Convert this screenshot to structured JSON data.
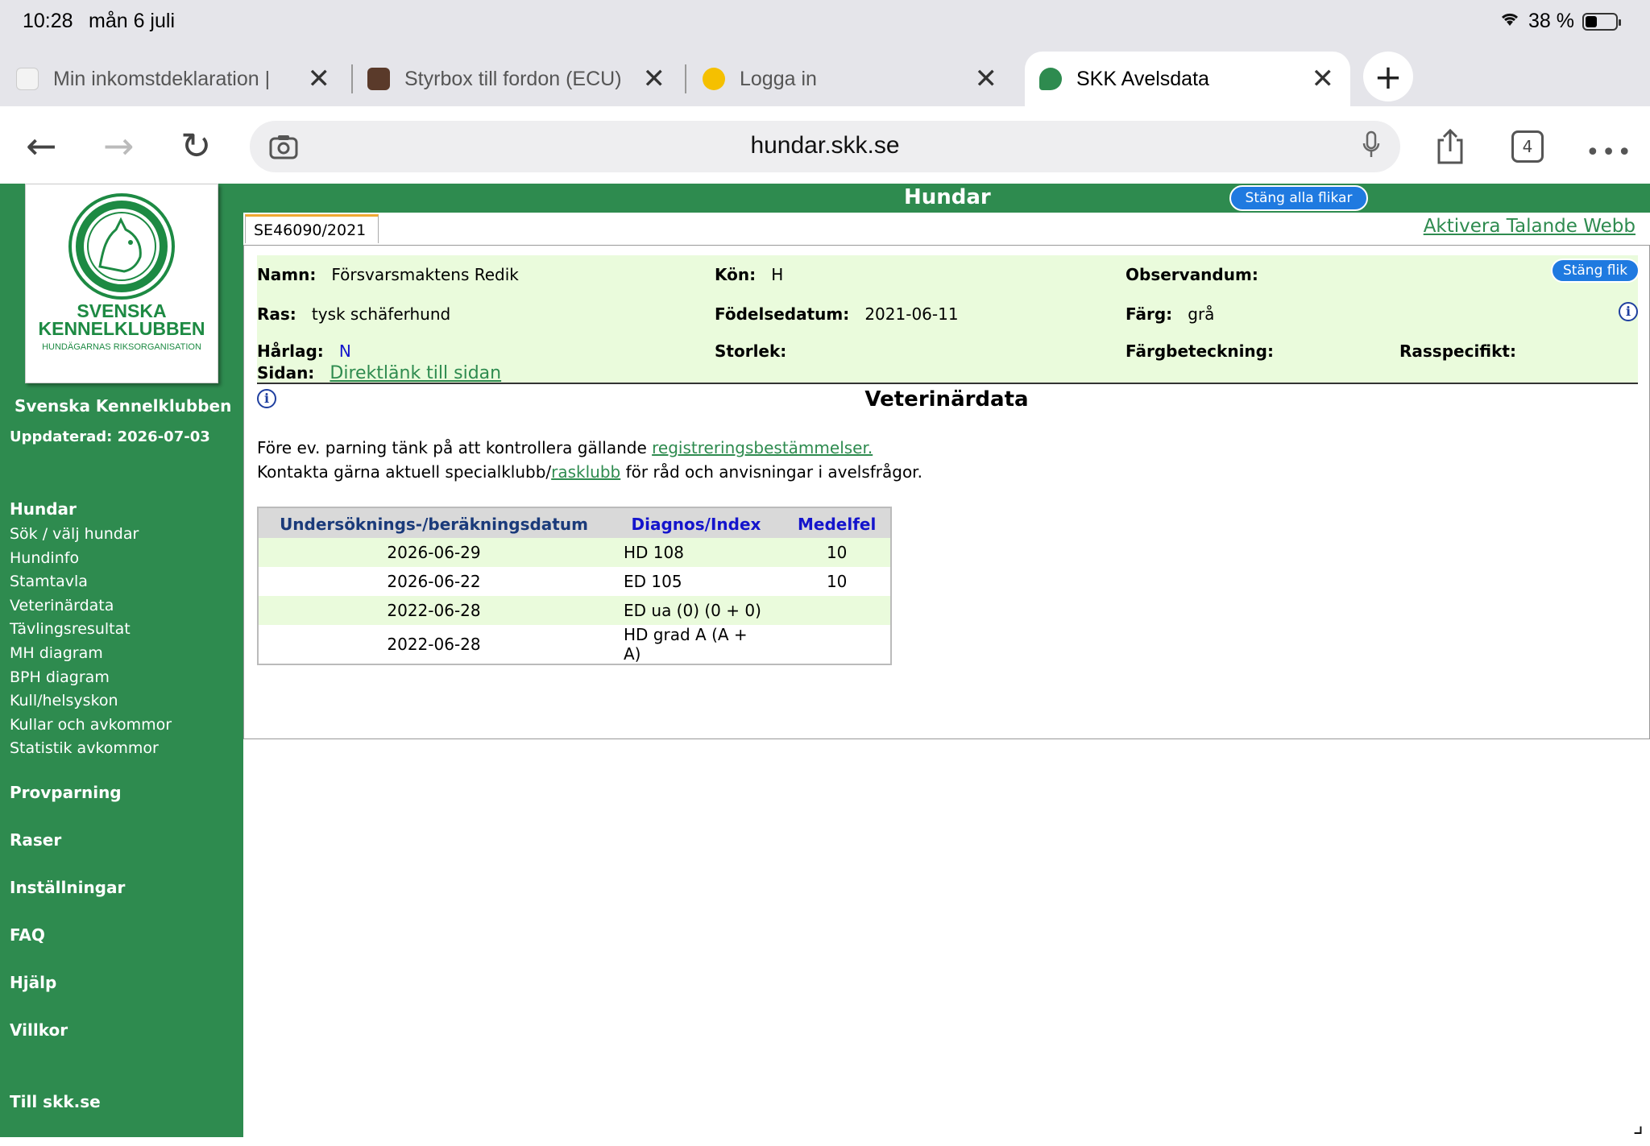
{
  "status_bar": {
    "time": "10:28",
    "date": "mån 6 juli",
    "battery": "38 %"
  },
  "browser": {
    "tabs": [
      {
        "title": "Min inkomstdeklaration |",
        "active": false
      },
      {
        "title": "Styrbox till fordon (ECU)",
        "active": false
      },
      {
        "title": "Logga in",
        "active": false
      },
      {
        "title": "SKK Avelsdata",
        "active": true
      }
    ],
    "url": "hundar.skk.se",
    "tab_count": "4"
  },
  "sidebar": {
    "logo_line1": "SVENSKA",
    "logo_line2": "KENNELKLUBBEN",
    "logo_line3": "HUNDÄGARNAS RIKSORGANISATION",
    "club_name": "Svenska Kennelklubben",
    "updated": "Uppdaterad: 2026-07-03",
    "nav_heading": "Hundar",
    "nav_items": [
      "Sök / välj hundar",
      "Hundinfo",
      "Stamtavla",
      "Veterinärdata",
      "Tävlingsresultat",
      "MH diagram",
      "BPH diagram",
      "Kull/helsyskon",
      "Kullar och avkommor",
      "Statistik avkommor"
    ],
    "sections": [
      "Provparning",
      "Raser",
      "Inställningar",
      "FAQ",
      "Hjälp",
      "Villkor"
    ],
    "footer_link": "Till skk.se"
  },
  "header": {
    "title": "Hundar",
    "close_all": "Stäng alla flikar",
    "tab_label": "SE46090/2021",
    "speak_link": "Aktivera Talande Webb"
  },
  "dog": {
    "name_label": "Namn:",
    "name": "Försvarsmaktens Redik",
    "sex_label": "Kön:",
    "sex": "H",
    "observandum_label": "Observandum:",
    "close_tab": "Stäng flik",
    "breed_label": "Ras:",
    "breed": "tysk schäferhund",
    "birth_label": "Födelsedatum:",
    "birth": "2021-06-11",
    "color_label": "Färg:",
    "color": "grå",
    "coat_label": "Hårlag:",
    "coat": "N",
    "size_label": "Storlek:",
    "marking_label": "Färgbeteckning:",
    "breed_specific_label": "Rasspecifikt:",
    "page_label": "Sidan:",
    "page_link": "Direktlänk till sidan"
  },
  "vet": {
    "title": "Veterinärdata",
    "note1_prefix": "Före ev. parning tänk på att kontrollera gällande ",
    "note1_link": "registreringsbestämmelser.",
    "note2_prefix": "Kontakta gärna aktuell specialklubb/",
    "note2_link": "rasklubb",
    "note2_suffix": " för råd och anvisningar i avelsfrågor.",
    "columns": [
      "Undersöknings-/beräkningsdatum",
      "Diagnos/Index",
      "Medelfel"
    ],
    "rows": [
      {
        "date": "2026-06-29",
        "diagnosis": "HD 108",
        "error": "10"
      },
      {
        "date": "2026-06-22",
        "diagnosis": "ED 105",
        "error": "10"
      },
      {
        "date": "2022-06-28",
        "diagnosis": "ED ua (0) (0 + 0)",
        "error": ""
      },
      {
        "date": "2022-06-28",
        "diagnosis": "HD grad A (A + A)",
        "error": ""
      }
    ]
  },
  "colors": {
    "green": "#2e8b4f",
    "light_green": "#eafbdc",
    "blue_button": "#1f7ae0"
  }
}
